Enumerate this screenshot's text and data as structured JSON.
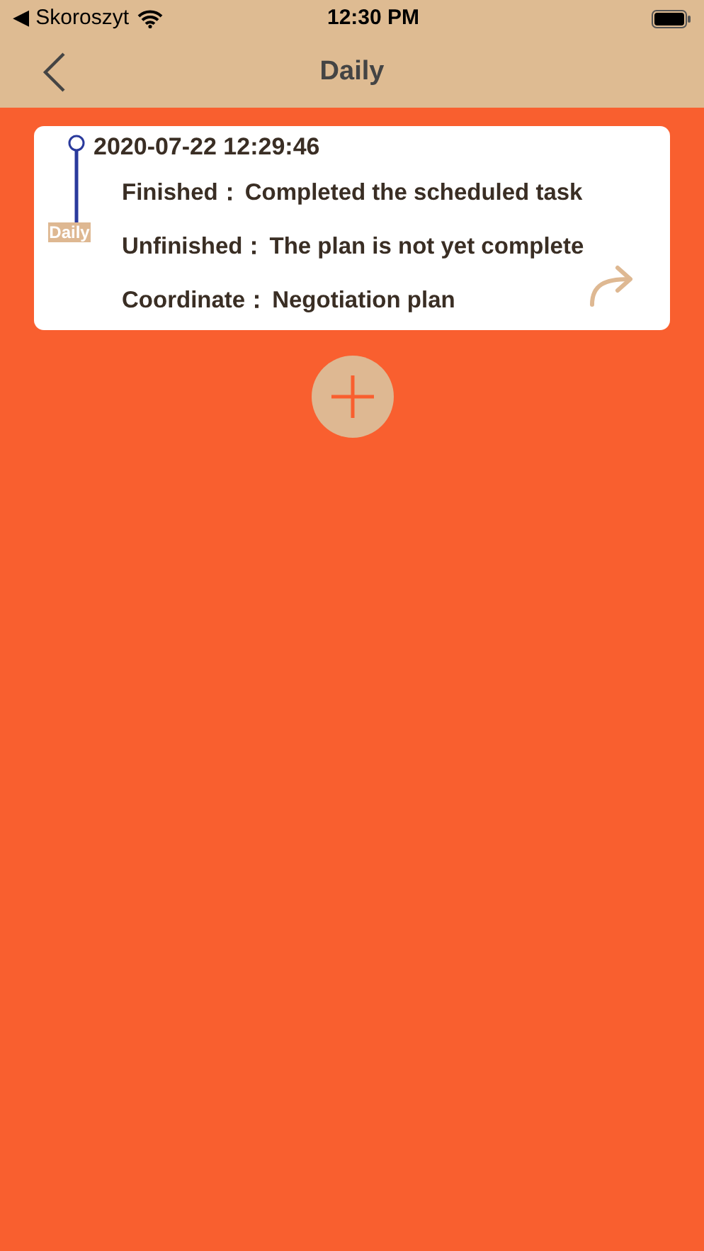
{
  "status_bar": {
    "back_app": "◀ Skoroszyt",
    "time": "12:30 PM"
  },
  "nav": {
    "title": "Daily"
  },
  "entries": [
    {
      "timestamp": "2020-07-22 12:29:46",
      "tag": "Daily",
      "fields": [
        {
          "label": "Finished：",
          "value": "Completed the scheduled task"
        },
        {
          "label": "Unfinished：",
          "value": "The plan is not yet complete"
        },
        {
          "label": "Coordinate：",
          "value": "Negotiation plan"
        }
      ]
    }
  ]
}
